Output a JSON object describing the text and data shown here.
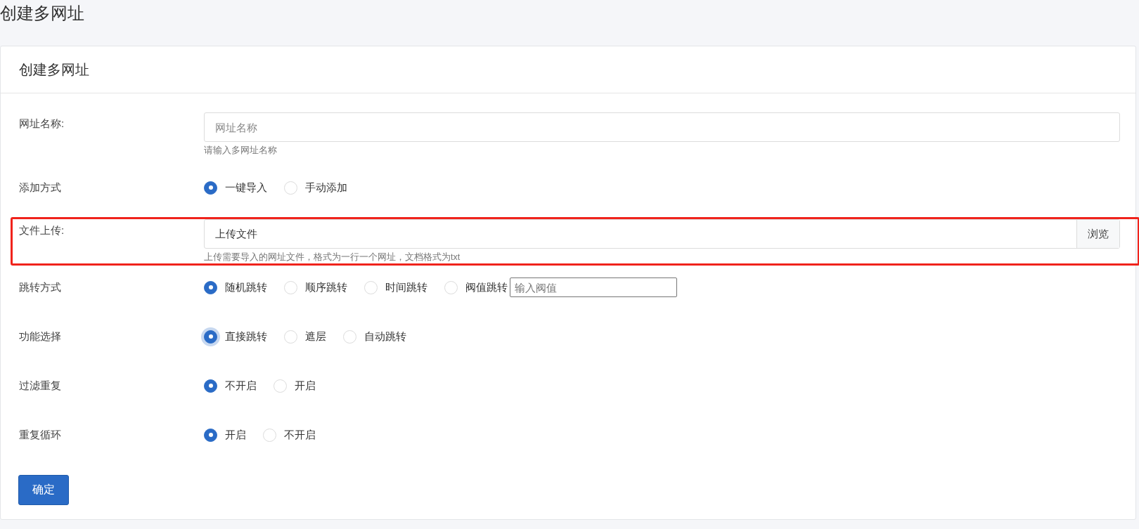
{
  "page_title": "创建多网址",
  "card": {
    "title": "创建多网址",
    "fields": [
      {
        "kind": "text",
        "label": "网址名称:",
        "placeholder": "网址名称",
        "help": "请输入多网址名称",
        "highlighted": false
      },
      {
        "kind": "radio",
        "label": "添加方式",
        "highlighted": false,
        "options": [
          {
            "label": "一键导入",
            "selected": true
          },
          {
            "label": "手动添加",
            "selected": false
          }
        ]
      },
      {
        "kind": "file",
        "label": "文件上传:",
        "value": "上传文件",
        "button": "浏览",
        "help": "上传需要导入的网址文件，格式为一行一个网址，文档格式为txt",
        "highlighted": true
      },
      {
        "kind": "radio",
        "label": "跳转方式",
        "highlighted": false,
        "options": [
          {
            "label": "随机跳转",
            "selected": true
          },
          {
            "label": "顺序跳转",
            "selected": false
          },
          {
            "label": "时间跳转",
            "selected": false
          },
          {
            "label": "阀值跳转",
            "selected": false
          }
        ],
        "threshold_input": {
          "placeholder": "输入阀值"
        }
      },
      {
        "kind": "radio",
        "label": "功能选择",
        "highlighted": false,
        "options": [
          {
            "label": "直接跳转",
            "selected": true,
            "focused": true
          },
          {
            "label": "遮层",
            "selected": false,
            "focused": false
          },
          {
            "label": "自动跳转",
            "selected": false,
            "focused": false
          }
        ]
      },
      {
        "kind": "radio",
        "label": "过滤重复",
        "highlighted": false,
        "options": [
          {
            "label": "不开启",
            "selected": true
          },
          {
            "label": "开启",
            "selected": false
          }
        ]
      },
      {
        "kind": "radio",
        "label": "重复循环",
        "highlighted": false,
        "options": [
          {
            "label": "开启",
            "selected": true
          },
          {
            "label": "不开启",
            "selected": false
          }
        ]
      }
    ],
    "submit": "确定"
  }
}
